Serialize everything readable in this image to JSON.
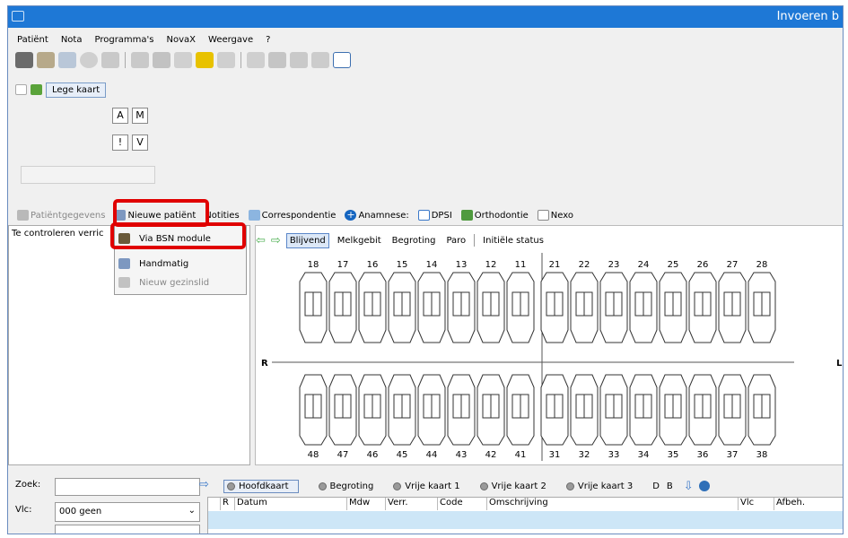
{
  "window": {
    "title": "Invoeren b"
  },
  "menu": [
    "Patiënt",
    "Nota",
    "Programma's",
    "NovaX",
    "Weergave",
    "?"
  ],
  "toolbar": {
    "lege_kaart": "Lege kaart"
  },
  "keys": [
    "A",
    "M",
    "!",
    "V"
  ],
  "actionbar": {
    "patientgegevens": "Patiëntgegevens",
    "nieuwe_patient": "Nieuwe patiënt",
    "notities": "Notities",
    "correspondentie": "Correspondentie",
    "anamnese": "Anamnese:",
    "dpsi": "DPSI",
    "orthodontie": "Orthodontie",
    "nexo": "Nexo"
  },
  "leftpanel": {
    "label": "Te controleren verric"
  },
  "dropdown": {
    "items": [
      {
        "label": "Via BSN module",
        "enabled": true
      },
      {
        "label": "Handmatig",
        "enabled": true
      },
      {
        "label": "Nieuw gezinslid",
        "enabled": false
      }
    ]
  },
  "chart": {
    "tabs": [
      "Blijvend",
      "Melkgebit",
      "Begroting",
      "Paro",
      "Initiële status"
    ],
    "active_tab": "Blijvend",
    "upper_teeth": [
      "18",
      "17",
      "16",
      "15",
      "14",
      "13",
      "12",
      "11",
      "21",
      "22",
      "23",
      "24",
      "25",
      "26",
      "27",
      "28"
    ],
    "lower_teeth": [
      "48",
      "47",
      "46",
      "45",
      "44",
      "43",
      "42",
      "41",
      "31",
      "32",
      "33",
      "34",
      "35",
      "36",
      "37",
      "38"
    ],
    "right_label": "R",
    "left_label": "L"
  },
  "bottom": {
    "zoek_label": "Zoek:",
    "vlc_label": "Vlc:",
    "vlc_value": "000 geen",
    "radios": [
      "Hoofdkaart",
      "Begroting",
      "Vrije kaart 1",
      "Vrije kaart 2",
      "Vrije kaart 3"
    ],
    "active_radio": "Hoofdkaart",
    "db_labels": [
      "D",
      "B"
    ],
    "columns": [
      "R",
      "Datum",
      "Mdw",
      "Verr.",
      "Code",
      "Omschrijving",
      "Vlc",
      "Afbeh."
    ]
  },
  "colors": {
    "titlebar": "#1e78d6",
    "highlight": "#e00000",
    "active_tab": "#dce8f7"
  }
}
